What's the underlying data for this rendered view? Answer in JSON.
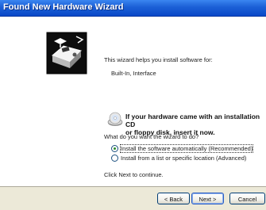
{
  "window": {
    "title": "Found New Hardware Wizard"
  },
  "content": {
    "intro": "This wizard helps you install software for:",
    "device": "Built-In, Interface",
    "cd_prompt_line1": "If your hardware came with an installation CD",
    "cd_prompt_line2": "or floppy disk, insert it now.",
    "question": "What do you want the wizard to do?",
    "options": [
      {
        "label": "Install the software automatically (Recommended)",
        "selected": true
      },
      {
        "label": "Install from a list or specific location (Advanced)",
        "selected": false
      }
    ],
    "continue_hint": "Click Next to continue."
  },
  "buttons": {
    "back": "< Back",
    "next": "Next >",
    "cancel": "Cancel"
  },
  "icons": {
    "wizard": "hardware-wizard-icon",
    "cd": "cd-drive-icon"
  },
  "colors": {
    "titlebar": "#0a48c8",
    "footer": "#ece9d8"
  }
}
